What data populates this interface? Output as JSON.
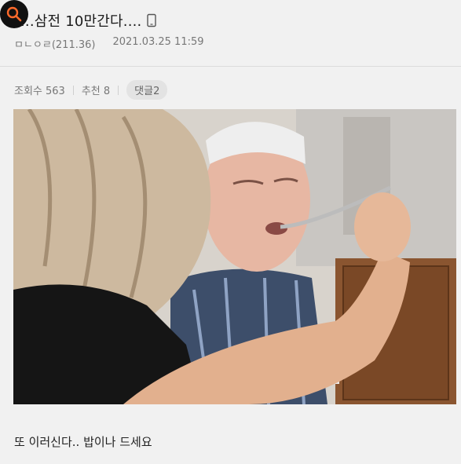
{
  "post": {
    "title": "...삼전 10만간다....",
    "author": "ㅁㄴㅇㄹ(211.36)",
    "datetime": "2021.03.25 11:59",
    "views": "조회수 563",
    "recommend": "추천 8",
    "comments": "댓글2",
    "body": "또 이러신다.. 밥이나 드세요"
  },
  "icons": [
    "search-icon",
    "phone-icon"
  ],
  "colors": {
    "background": "#f1f1f1",
    "fab": "#111111",
    "fab_icon": "#ff6a2b"
  }
}
